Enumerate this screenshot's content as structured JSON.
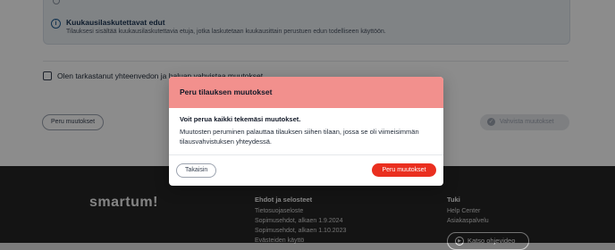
{
  "info_card": {
    "title": "Kuukausilaskutettavat edut",
    "description": "Tilauksesi sisältää kuukausilaskutettavia etuja, jotka laskutetaan kuukausittain perustuen edun todelliseen käyttöön."
  },
  "confirmation": {
    "checkbox_label": "Olen tarkastanut yhteenvedon ja haluan vahvistaa muutokset",
    "checked": false
  },
  "actions": {
    "undo_label": "Peru muutokset",
    "confirm_label": "Vahvista muutokset"
  },
  "footer": {
    "logo": "smartum!",
    "terms": {
      "heading": "Ehdot ja selosteet",
      "links": [
        "Tietosuojaseloste",
        "Sopimusehdot, alkaen 1.9.2024",
        "Sopimusehdot, alkaen 1.10.2023",
        "Evästeiden käyttö"
      ]
    },
    "support": {
      "heading": "Tuki",
      "links": [
        "Help Center",
        "Asiakaspalvelu"
      ],
      "video_label": "Katso ohjevideo"
    }
  },
  "modal": {
    "title": "Peru tilauksen muutokset",
    "heading": "Voit perua kaikki tekemäsi muutokset.",
    "body": "Muutosten peruminen palauttaa tilauksen siihen tilaan, jossa se oli viimeisimmän tilausvahvistuksen yhteydessä.",
    "back_label": "Takaisin",
    "cancel_label": "Peru muutokset"
  },
  "colors": {
    "modal_header": "#f2908d",
    "primary_danger": "#ea2f1f",
    "footer_bg": "#262626",
    "info_bg": "#e9eef3"
  }
}
